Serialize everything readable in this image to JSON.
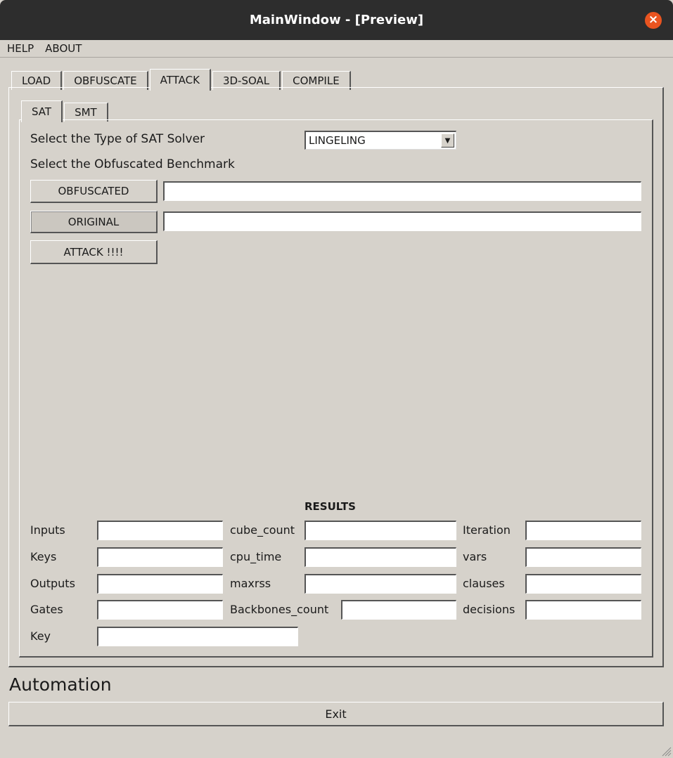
{
  "window": {
    "title": "MainWindow - [Preview]",
    "close_glyph": "×"
  },
  "menu": {
    "items": [
      "HELP",
      "ABOUT"
    ]
  },
  "tabs": {
    "main": [
      "LOAD",
      "OBFUSCATE",
      "ATTACK",
      "3D-SOAL",
      "COMPILE"
    ],
    "active_main": "ATTACK",
    "sub": [
      "SAT",
      "SMT"
    ],
    "active_sub": "SAT"
  },
  "sat": {
    "solver_label": "Select the Type of SAT Solver",
    "solver_value": "LINGELING",
    "benchmark_label": "Select the Obfuscated Benchmark",
    "obfuscated_button": "OBFUSCATED",
    "obfuscated_path": "",
    "original_button": "ORIGINAL",
    "original_path": "",
    "attack_button": "ATTACK !!!!"
  },
  "results": {
    "title": "RESULTS",
    "fields": {
      "inputs": {
        "label": "Inputs",
        "value": ""
      },
      "keys": {
        "label": "Keys",
        "value": ""
      },
      "outputs": {
        "label": "Outputs",
        "value": ""
      },
      "gates": {
        "label": "Gates",
        "value": ""
      },
      "key": {
        "label": "Key",
        "value": ""
      },
      "cube_count": {
        "label": "cube_count",
        "value": ""
      },
      "cpu_time": {
        "label": "cpu_time",
        "value": ""
      },
      "maxrss": {
        "label": "maxrss",
        "value": ""
      },
      "backbones_count": {
        "label": "Backbones_count",
        "value": ""
      },
      "iteration": {
        "label": "Iteration",
        "value": ""
      },
      "vars": {
        "label": "vars",
        "value": ""
      },
      "clauses": {
        "label": "clauses",
        "value": ""
      },
      "decisions": {
        "label": "decisions",
        "value": ""
      }
    }
  },
  "automation": {
    "label": "Automation",
    "exit_button": "Exit"
  },
  "icons": {
    "close": "close-icon",
    "dropdown": "chevron-down-icon",
    "resize": "resize-grip-icon"
  },
  "colors": {
    "titlebar": "#2d2d2d",
    "close": "#e95420",
    "window_bg": "#d6d2cb"
  }
}
